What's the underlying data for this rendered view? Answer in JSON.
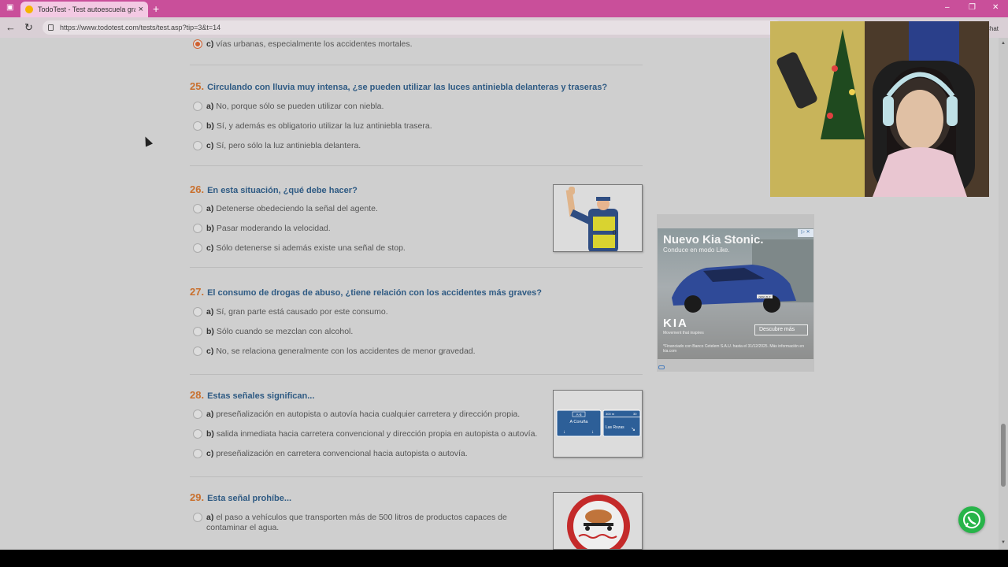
{
  "browser": {
    "tab_title": "TodoTest - Test autoescuela grati",
    "url": "https://www.todotest.com/tests/test.asp?tip=3&t=14",
    "chat_label": "Chat"
  },
  "questions": [
    {
      "id": "q24-tail",
      "options": [
        {
          "letter": "c)",
          "text": "vías urbanas, especialmente los accidentes mortales.",
          "selected": true
        }
      ]
    },
    {
      "number": "25.",
      "title": "Circulando con lluvia muy intensa, ¿se pueden utilizar las luces antiniebla delanteras y traseras?",
      "options": [
        {
          "letter": "a)",
          "text": "No, porque sólo se pueden utilizar con niebla."
        },
        {
          "letter": "b)",
          "text": "Sí, y además es obligatorio utilizar la luz antiniebla trasera."
        },
        {
          "letter": "c)",
          "text": "Sí, pero sólo la luz antiniebla delantera."
        }
      ]
    },
    {
      "number": "26.",
      "title": "En esta situación, ¿qué debe hacer?",
      "options": [
        {
          "letter": "a)",
          "text": "Detenerse obedeciendo la señal del agente."
        },
        {
          "letter": "b)",
          "text": "Pasar moderando la velocidad."
        },
        {
          "letter": "c)",
          "text": "Sólo detenerse si además existe una señal de stop."
        }
      ]
    },
    {
      "number": "27.",
      "title": "El consumo de drogas de abuso, ¿tiene relación con los accidentes más graves?",
      "options": [
        {
          "letter": "a)",
          "text": "Sí, gran parte está causado por este consumo."
        },
        {
          "letter": "b)",
          "text": "Sólo cuando se mezclan con alcohol."
        },
        {
          "letter": "c)",
          "text": "No, se relaciona generalmente con los accidentes de menor gravedad."
        }
      ]
    },
    {
      "number": "28.",
      "title": "Estas señales significan...",
      "options": [
        {
          "letter": "a)",
          "text": "preseñalización en autopista o autovía hacia cualquier carretera y dirección propia."
        },
        {
          "letter": "b)",
          "text": "salida inmediata hacia carretera convencional y dirección propia en autopista o autovía."
        },
        {
          "letter": "c)",
          "text": "preseñalización en carretera convencional hacia autopista o autovía."
        }
      ]
    },
    {
      "number": "29.",
      "title": "Esta señal prohíbe...",
      "options": [
        {
          "letter": "a)",
          "text": "el paso a vehículos que transporten más de 500 litros de productos capaces de contaminar el agua."
        }
      ]
    }
  ],
  "signs": {
    "left_code": "A-6",
    "left_city": "A Coruña",
    "right_dist": "300 m",
    "right_code": "30",
    "right_city": "Las Rozas",
    "officer_badge": "0"
  },
  "ad": {
    "title": "Nuevo Kia Stonic.",
    "subtitle": "Conduce en modo Like.",
    "brand": "KIA",
    "brand_sub": "Movement that inspires",
    "cta": "Descubre más",
    "legal": "*Financiado con Banco Cetelem S.A.U. hasta el 31/12/2025. Más información en kia.com",
    "plate": "0000 ZLZ"
  },
  "colors": {
    "accent_number": "#c9702e",
    "question_title": "#2e5a83",
    "tab_bar": "#c94f9a",
    "whatsapp": "#27b449"
  }
}
